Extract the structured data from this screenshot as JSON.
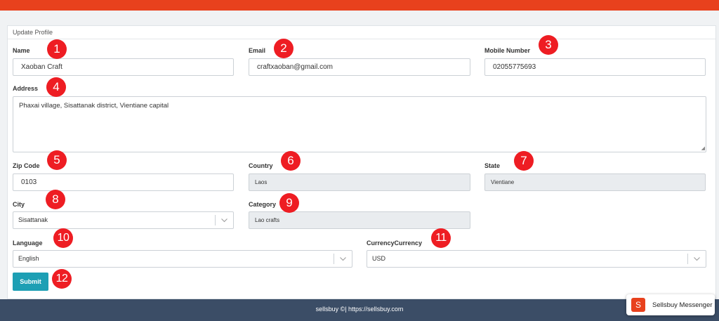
{
  "footer_text": "sellsbuy ©| https://sellsbuy.com",
  "messenger_label": "Sellsbuy Messenger",
  "form": {
    "title": "Update Profile",
    "name": {
      "label": "Name",
      "value": "Xaoban Craft"
    },
    "email": {
      "label": "Email",
      "value": "craftxaoban@gmail.com"
    },
    "mobile": {
      "label": "Mobile Number",
      "value": "02055775693"
    },
    "address": {
      "label": "Address",
      "value": "Phaxai village, Sisattanak district, Vientiane capital"
    },
    "zip": {
      "label": "Zip Code",
      "value": "0103"
    },
    "country": {
      "label": "Country",
      "value": "Laos"
    },
    "state": {
      "label": "State",
      "value": "Vientiane"
    },
    "city": {
      "label": "City",
      "value": "Sisattanak"
    },
    "category": {
      "label": "Category",
      "value": "Lao crafts"
    },
    "language": {
      "label": "Language",
      "value": "English"
    },
    "currency": {
      "label": "CurrencyCurrency",
      "value": "USD"
    },
    "submit_label": "Submit"
  },
  "annotations": [
    "1",
    "2",
    "3",
    "4",
    "5",
    "6",
    "7",
    "8",
    "9",
    "10",
    "11",
    "12"
  ],
  "colors": {
    "topbar": "#e8411d",
    "submit": "#1d9fb4",
    "footer": "#3b4d66",
    "badge": "#ee1d23"
  }
}
